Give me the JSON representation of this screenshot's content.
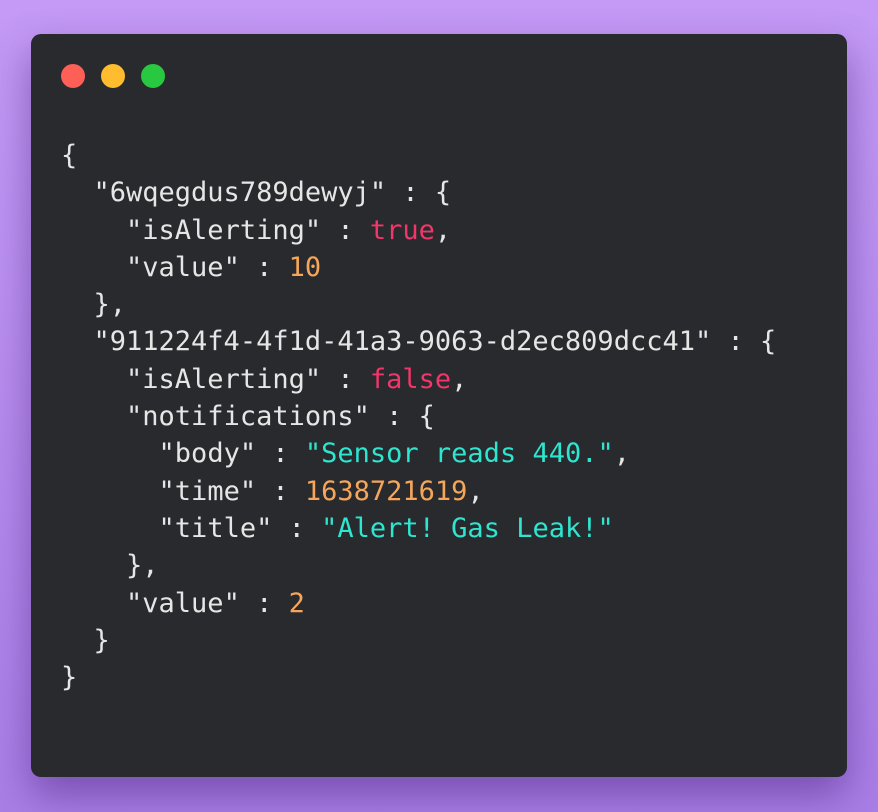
{
  "colors": {
    "background_top": "#c49af6",
    "background_bottom": "#a97ee6",
    "window": "#282a2e",
    "punctuation": "#e6e6e6",
    "boolean": "#f0366a",
    "number": "#f6a65a",
    "string": "#2ee6d0",
    "close": "#fe5f57",
    "minimize": "#febc2e",
    "maximize": "#28c840"
  },
  "window_controls": [
    {
      "name": "close-button",
      "icon": "red-dot"
    },
    {
      "name": "minimize-button",
      "icon": "yellow-dot"
    },
    {
      "name": "maximize-button",
      "icon": "green-dot"
    }
  ],
  "code": {
    "open_brace": "{",
    "sensor1": {
      "key": "\"6wqegdus789dewyj\"",
      "is_alerting_key": "\"isAlerting\"",
      "is_alerting_value": "true",
      "value_key": "\"value\"",
      "value_value": "10"
    },
    "sensor2": {
      "key": "\"911224f4-4f1d-41a3-9063-d2ec809dcc41\"",
      "is_alerting_key": "\"isAlerting\"",
      "is_alerting_value": "false",
      "notifications_key": "\"notifications\"",
      "body_key": "\"body\"",
      "body_value": "\"Sensor reads 440.\"",
      "time_key": "\"time\"",
      "time_value": "1638721619",
      "title_key": "\"title\"",
      "title_value": "\"Alert! Gas Leak!\"",
      "value_key": "\"value\"",
      "value_value": "2"
    },
    "close_brace": "}"
  }
}
